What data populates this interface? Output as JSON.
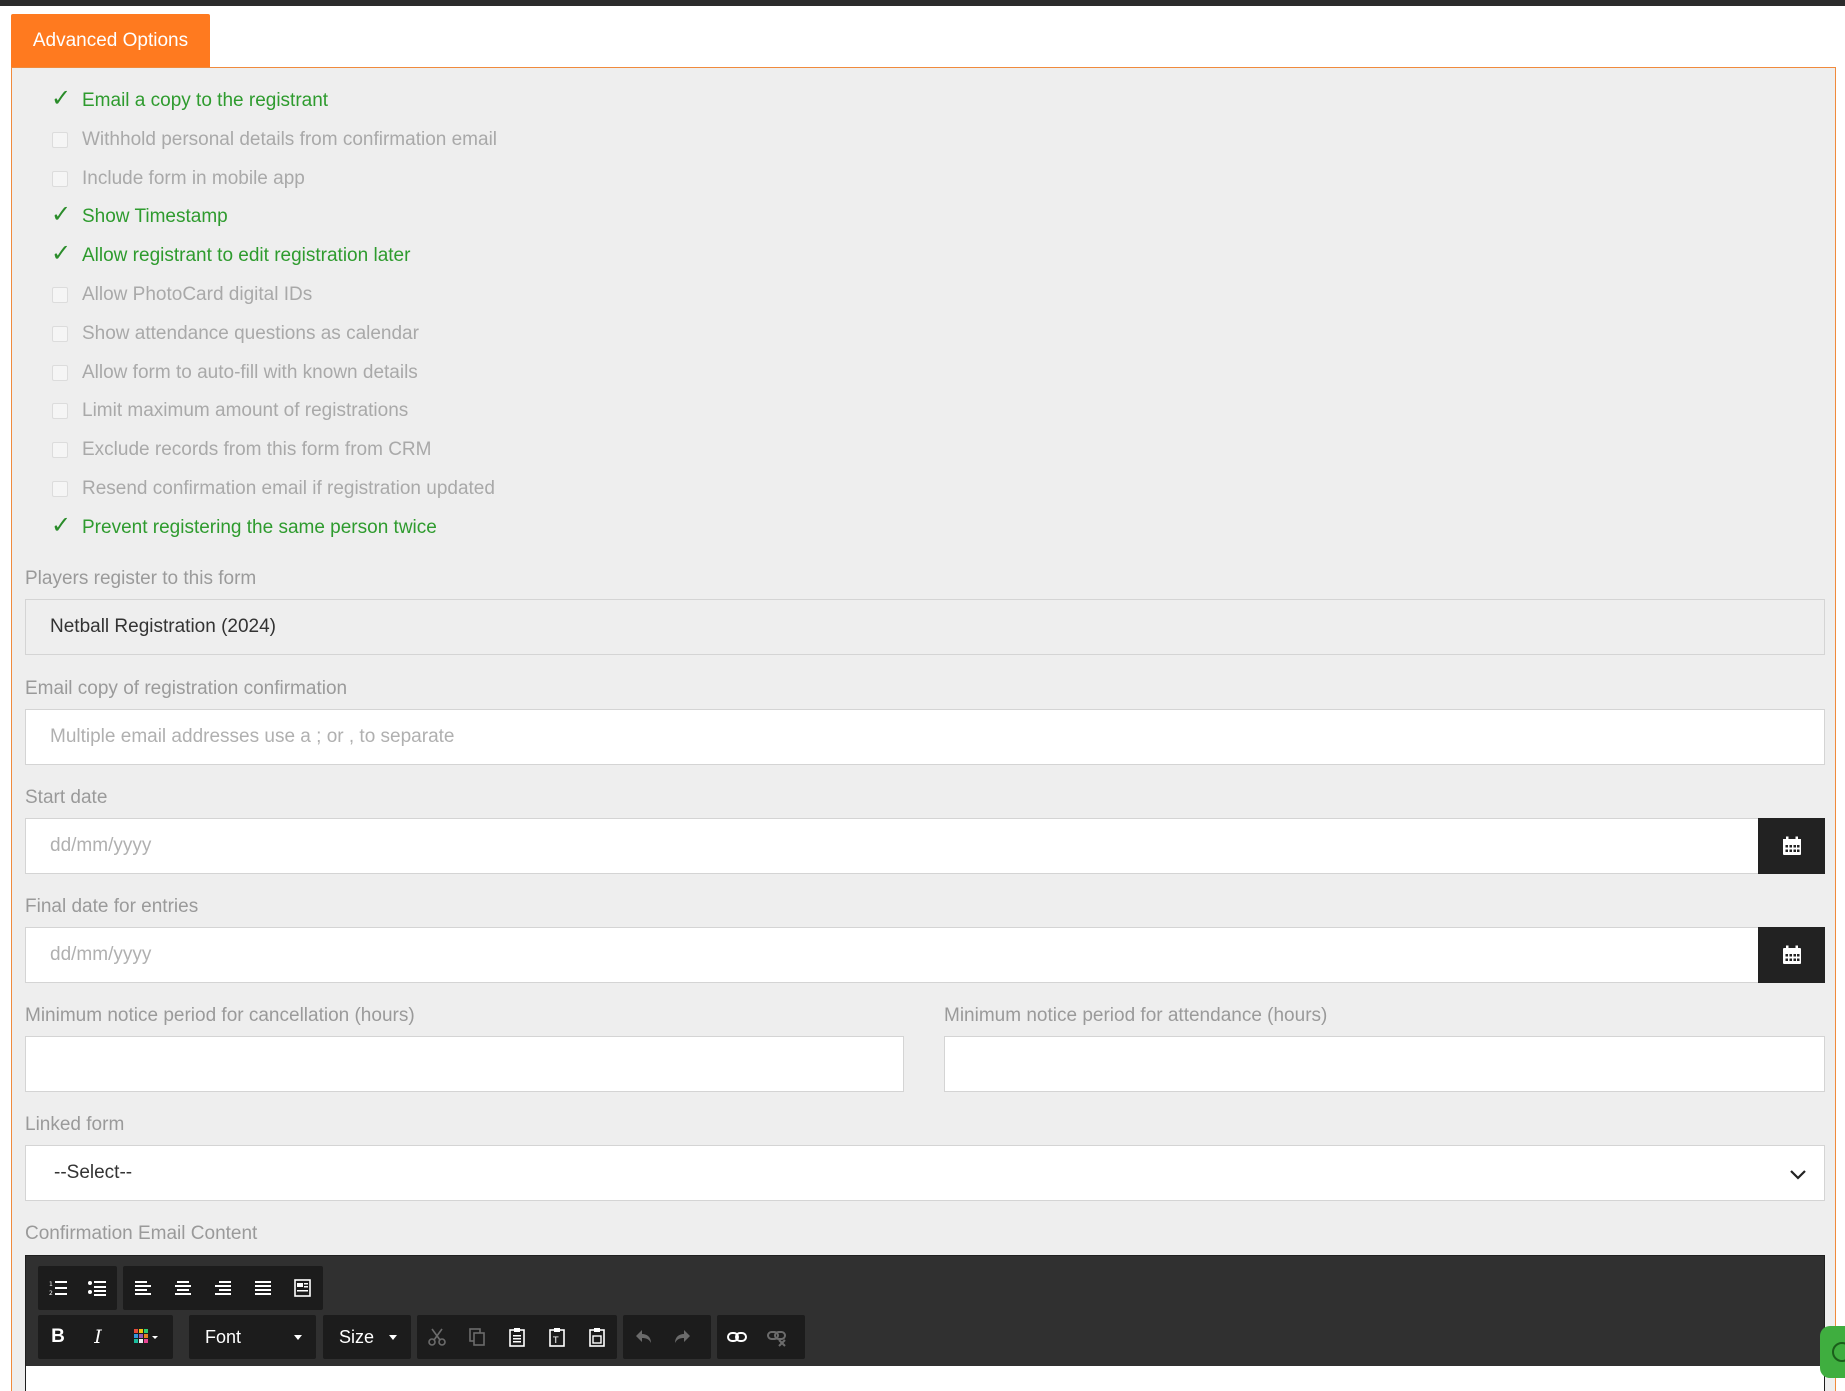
{
  "tab": {
    "label": "Advanced Options"
  },
  "options": [
    {
      "label": "Email a copy to the registrant",
      "checked": true
    },
    {
      "label": "Withhold personal details from confirmation email",
      "checked": false
    },
    {
      "label": "Include form in mobile app",
      "checked": false
    },
    {
      "label": "Show Timestamp",
      "checked": true
    },
    {
      "label": "Allow registrant to edit registration later",
      "checked": true
    },
    {
      "label": "Allow PhotoCard digital IDs",
      "checked": false
    },
    {
      "label": "Show attendance questions as calendar",
      "checked": false
    },
    {
      "label": "Allow form to auto-fill with known details",
      "checked": false
    },
    {
      "label": "Limit maximum amount of registrations",
      "checked": false
    },
    {
      "label": "Exclude records from this form from CRM",
      "checked": false
    },
    {
      "label": "Resend confirmation email if registration updated",
      "checked": false
    },
    {
      "label": "Prevent registering the same person twice",
      "checked": true
    }
  ],
  "players_form": {
    "label": "Players register to this form",
    "value": "Netball Registration (2024)"
  },
  "email_copy": {
    "label": "Email copy of registration confirmation",
    "placeholder": "Multiple email addresses use a ; or , to separate",
    "value": ""
  },
  "start_date": {
    "label": "Start date",
    "placeholder": "dd/mm/yyyy",
    "value": ""
  },
  "final_date": {
    "label": "Final date for entries",
    "placeholder": "dd/mm/yyyy",
    "value": ""
  },
  "notice_cancellation": {
    "label": "Minimum notice period for cancellation (hours)",
    "value": ""
  },
  "notice_attendance": {
    "label": "Minimum notice period for attendance (hours)",
    "value": ""
  },
  "linked_form": {
    "label": "Linked form",
    "selected": "--Select--"
  },
  "confirmation_email": {
    "label": "Confirmation Email Content",
    "toolbar": {
      "font_label": "Font",
      "size_label": "Size",
      "bold": "B",
      "italic": "I"
    }
  },
  "colors": {
    "accent": "#ff7a1f",
    "checked_text": "#2e9b2e",
    "toolbar_bg": "#303030"
  }
}
